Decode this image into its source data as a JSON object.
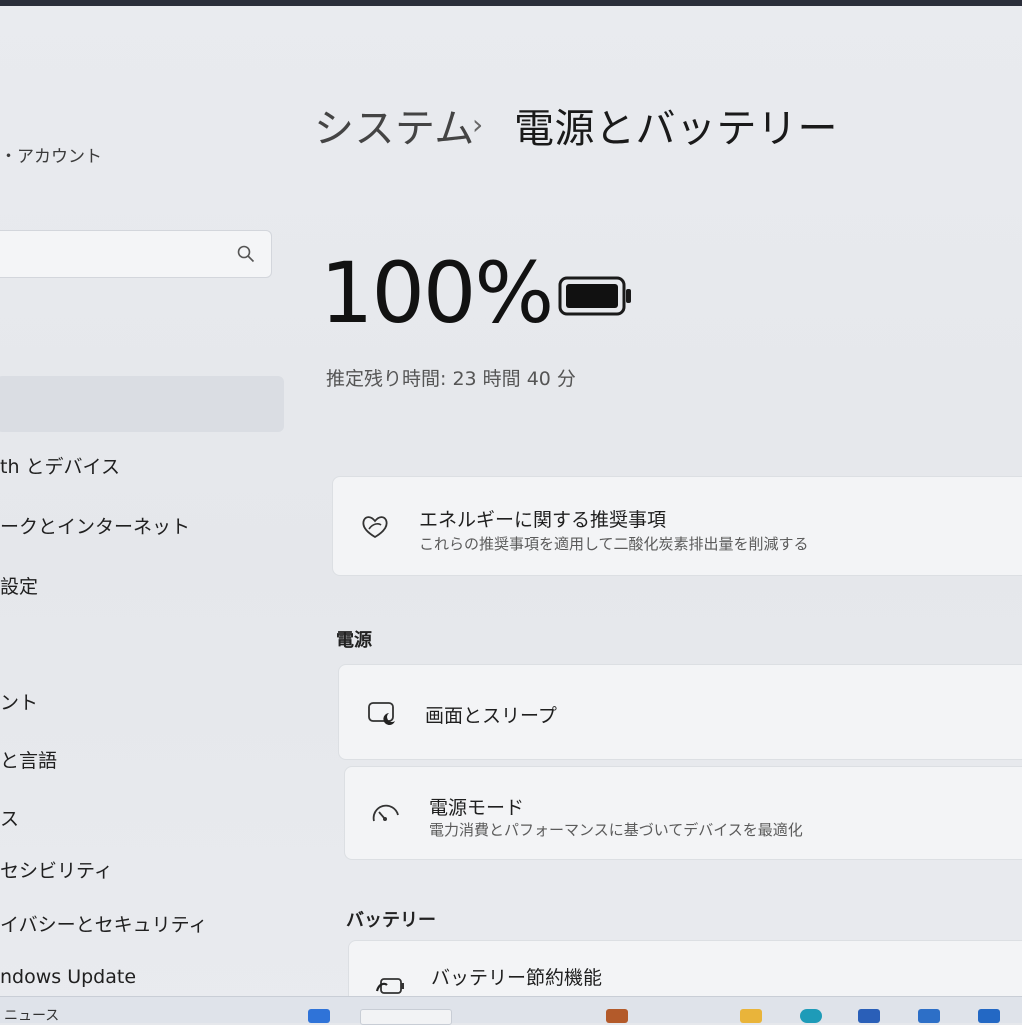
{
  "sidebar": {
    "account_label": "・アカウント",
    "search_icon": "search-icon",
    "items": [
      {
        "label": "th とデバイス"
      },
      {
        "label": "ークとインターネット"
      },
      {
        "label": "設定"
      },
      {
        "label": "ント"
      },
      {
        "label": "と言語"
      },
      {
        "label": "ス"
      },
      {
        "label": "セシビリティ"
      },
      {
        "label": "イバシーとセキュリティ"
      },
      {
        "label": "ndows Update"
      }
    ]
  },
  "header": {
    "breadcrumb_parent": "システム",
    "breadcrumb_separator": "›",
    "breadcrumb_current": "電源とバッテリー"
  },
  "battery": {
    "percent_text": "100%",
    "level": 1.0,
    "remaining_text": "推定残り時間: 23 時間 40 分"
  },
  "energy_card": {
    "title": "エネルギーに関する推奨事項",
    "subtitle": "これらの推奨事項を適用して二酸化炭素排出量を削減する",
    "icon": "leaf-heart-icon"
  },
  "power_section": {
    "heading": "電源",
    "items": [
      {
        "title": "画面とスリープ",
        "icon": "screen-sleep-icon"
      },
      {
        "title": "電源モード",
        "subtitle": "電力消費とパフォーマンスに基づいてデバイスを最適化",
        "icon": "gauge-icon"
      }
    ]
  },
  "battery_section": {
    "heading": "バッテリー",
    "items": [
      {
        "title": "バッテリー節約機能",
        "icon": "battery-saver-icon"
      }
    ]
  },
  "taskbar": {
    "news_label": "ニュース"
  },
  "colors": {
    "background": "#e6e8ec",
    "card": "#f3f4f6",
    "text": "#1b1b1b"
  }
}
